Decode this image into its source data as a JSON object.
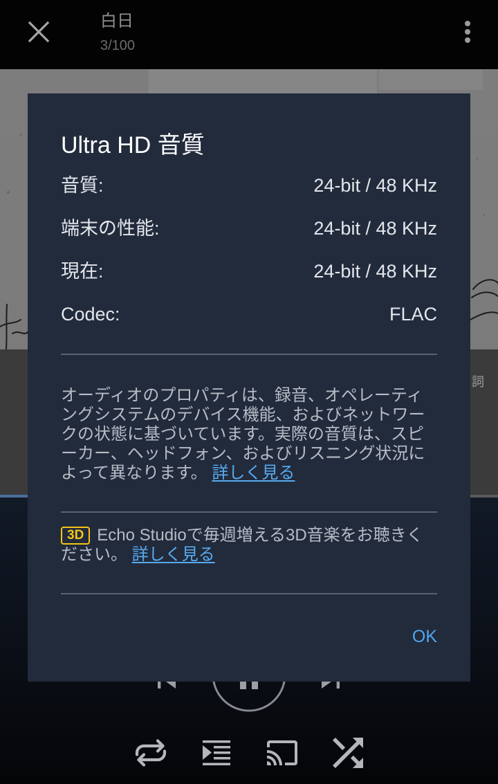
{
  "top_bar": {
    "close_icon": "close-icon",
    "title": "白日",
    "track_index": "3/100",
    "menu_icon": "more-vert-icon"
  },
  "player": {
    "lyrics_label": "詞",
    "controls": {
      "previous_icon": "skip-previous-icon",
      "play_pause_icon": "pause-icon",
      "next_icon": "skip-next-icon"
    },
    "actions": [
      {
        "icon": "repeat-icon"
      },
      {
        "icon": "queue-icon"
      },
      {
        "icon": "cast-icon"
      },
      {
        "icon": "shuffle-icon"
      }
    ]
  },
  "dialog": {
    "title": "Ultra HD 音質",
    "specs": [
      {
        "label": "音質:",
        "value": "24-bit / 48 KHz"
      },
      {
        "label": "端末の性能:",
        "value": "24-bit / 48 KHz"
      },
      {
        "label": "現在:",
        "value": "24-bit / 48 KHz"
      },
      {
        "label": "Codec:",
        "value": "FLAC"
      }
    ],
    "description": "オーディオのプロパティは、録音、オペレーティングシステムのデバイス機能、およびネットワークの状態に基づいています。実際の音質は、スピーカー、ヘッドフォン、およびリスニング状況によって異なります。",
    "description_link": "詳しく見る",
    "badge": "3D",
    "promo": "Echo Studioで毎週増える3D音楽をお聴きください。",
    "promo_link": "詳しく見る",
    "ok_label": "OK"
  },
  "colors": {
    "dialog_background": "#222b3c",
    "link": "#57aaf0",
    "ok_button": "#4fa6ec",
    "badge": "#f5c518",
    "seek_fill": "#4a6d9b"
  }
}
